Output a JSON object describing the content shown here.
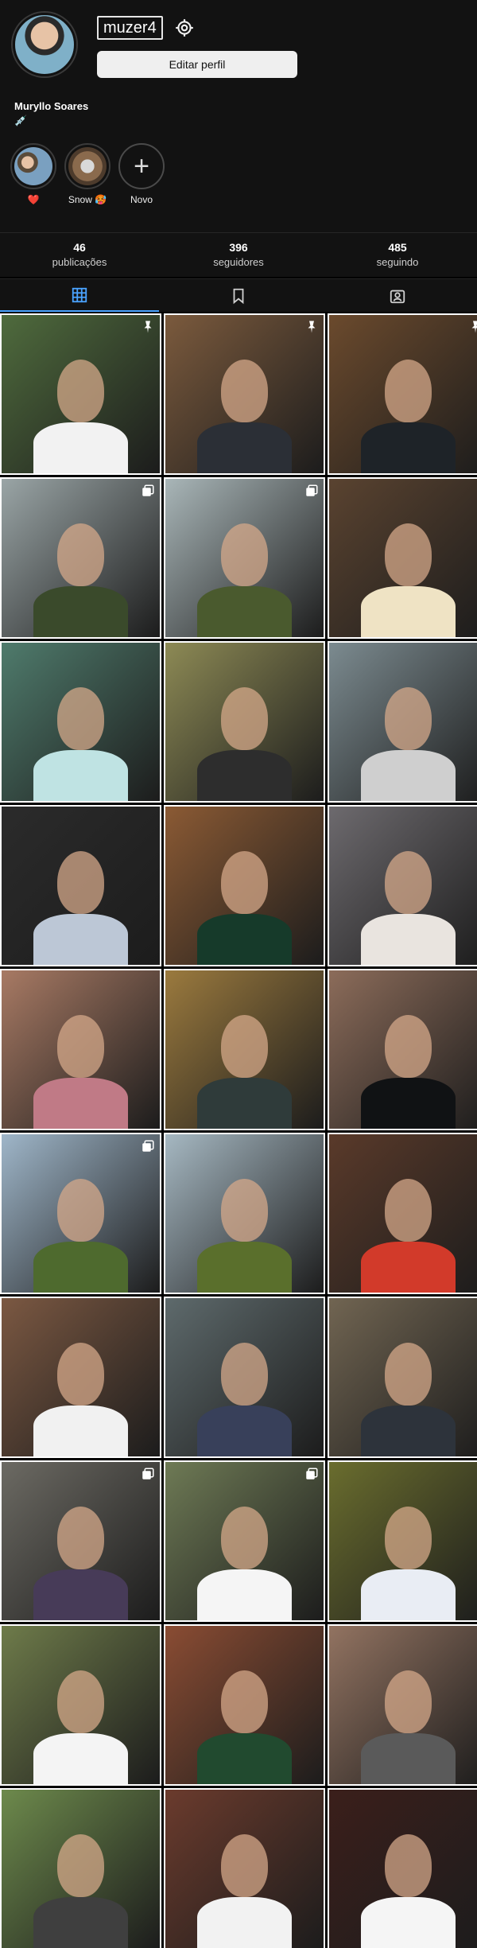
{
  "profile": {
    "username": "muzer4",
    "edit_label": "Editar perfil",
    "full_name": "Muryllo Soares",
    "bio_glyph": "💉"
  },
  "stories": [
    {
      "label": "❤️",
      "icon": "story-highlight"
    },
    {
      "label": "Snow 🥵",
      "icon": "story-highlight"
    },
    {
      "label": "Novo",
      "icon": "plus-icon"
    }
  ],
  "stats": [
    {
      "value": "46",
      "label": "publicações"
    },
    {
      "value": "396",
      "label": "seguidores"
    },
    {
      "value": "485",
      "label": "seguindo"
    }
  ],
  "tabs": [
    {
      "name": "grid-icon",
      "active": true
    },
    {
      "name": "saved-icon",
      "active": false
    },
    {
      "name": "tagged-icon",
      "active": false
    }
  ],
  "colors": {
    "background": "#000000",
    "header": "#121212",
    "accent": "#4aa3ff"
  },
  "posts": [
    {
      "bg": "#4f6b3d",
      "body": "#f2f2f2",
      "badge": "pin-icon"
    },
    {
      "bg": "#7b5a3d",
      "body": "#2b2f36",
      "badge": "pin-icon"
    },
    {
      "bg": "#6b4a2d",
      "body": "#1e2328",
      "badge": "pin-icon"
    },
    {
      "bg": "#9aa5a6",
      "body": "#3a4a2b",
      "badge": "carousel-icon"
    },
    {
      "bg": "#a9b6b8",
      "body": "#4a5a2e",
      "badge": "carousel-icon"
    },
    {
      "bg": "#5a4330",
      "body": "#efe3c4",
      "badge": ""
    },
    {
      "bg": "#4f7b6c",
      "body": "#bfe3e3",
      "badge": ""
    },
    {
      "bg": "#8d8a55",
      "body": "#2d2d2d",
      "badge": ""
    },
    {
      "bg": "#7c8b90",
      "body": "#cfcfcf",
      "badge": ""
    },
    {
      "bg": "#2b2b2b",
      "body": "#bcc7d6",
      "badge": ""
    },
    {
      "bg": "#8b5a34",
      "body": "#163a2a",
      "badge": ""
    },
    {
      "bg": "#6d6a6e",
      "body": "#e9e4df",
      "badge": ""
    },
    {
      "bg": "#a87a64",
      "body": "#c07a86",
      "badge": ""
    },
    {
      "bg": "#9b7a3e",
      "body": "#2f3b3a",
      "badge": ""
    },
    {
      "bg": "#8c6c5a",
      "body": "#101214",
      "badge": ""
    },
    {
      "bg": "#9fb6c9",
      "body": "#4e6a2e",
      "badge": "carousel-icon"
    },
    {
      "bg": "#a6b8c2",
      "body": "#5a6f2c",
      "badge": ""
    },
    {
      "bg": "#5a3a2a",
      "body": "#d23a2a",
      "badge": ""
    },
    {
      "bg": "#7b5842",
      "body": "#f1f1f1",
      "badge": ""
    },
    {
      "bg": "#5e6a6c",
      "body": "#38405a",
      "badge": ""
    },
    {
      "bg": "#716552",
      "body": "#2d333b",
      "badge": ""
    },
    {
      "bg": "#6c6a63",
      "body": "#473b58",
      "badge": "carousel-icon"
    },
    {
      "bg": "#6e7a55",
      "body": "#f5f5f5",
      "badge": "carousel-icon"
    },
    {
      "bg": "#6a6d2e",
      "body": "#e9edf4",
      "badge": ""
    },
    {
      "bg": "#6e7b4a",
      "body": "#f4f4f4",
      "badge": ""
    },
    {
      "bg": "#8a4c33",
      "body": "#214a2f",
      "badge": ""
    },
    {
      "bg": "#927361",
      "body": "#5a5a5a",
      "badge": ""
    },
    {
      "bg": "#6d8a4c",
      "body": "#3f3f3f",
      "badge": ""
    },
    {
      "bg": "#6b3b2d",
      "body": "#f2f2f2",
      "badge": ""
    },
    {
      "bg": "#3b1f1b",
      "body": "#f5f5f5",
      "badge": ""
    }
  ]
}
